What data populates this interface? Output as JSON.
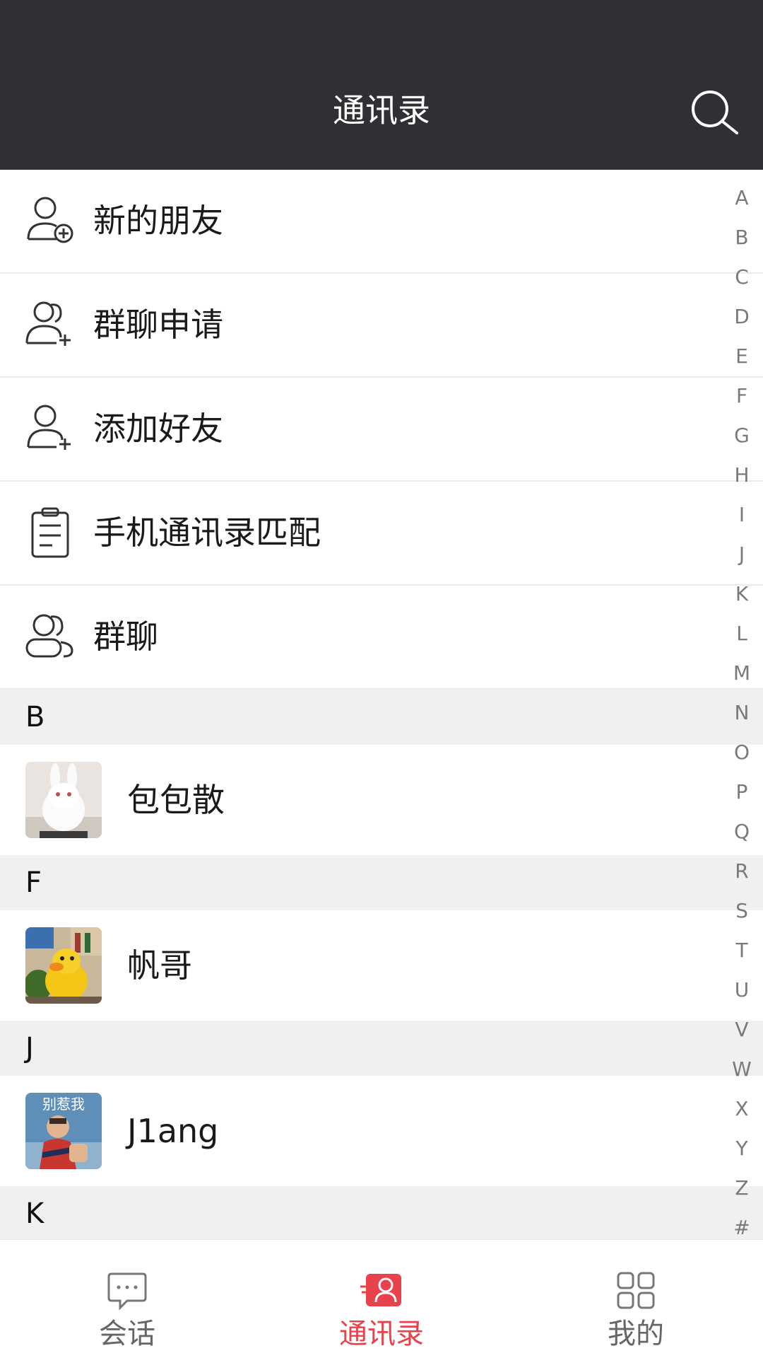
{
  "header": {
    "title": "通讯录",
    "search_icon": "search-icon"
  },
  "functions": [
    {
      "label": "新的朋友",
      "icon": "add-contact-icon"
    },
    {
      "label": "群聊申请",
      "icon": "group-add-icon"
    },
    {
      "label": "添加好友",
      "icon": "add-friend-icon"
    },
    {
      "label": "手机通讯录匹配",
      "icon": "clipboard-icon"
    },
    {
      "label": "群聊",
      "icon": "group-icon"
    }
  ],
  "sections": [
    {
      "letter": "B",
      "contacts": [
        {
          "name": "包包散",
          "avatar": "white-rabbit-avatar"
        }
      ]
    },
    {
      "letter": "F",
      "contacts": [
        {
          "name": "帆哥",
          "avatar": "yellow-duck-avatar"
        }
      ]
    },
    {
      "letter": "J",
      "contacts": [
        {
          "name": "J1ang",
          "avatar": "child-photo-avatar",
          "avatar_caption": "别惹我"
        }
      ]
    },
    {
      "letter": "K",
      "contacts": []
    }
  ],
  "index_letters": [
    "A",
    "B",
    "C",
    "D",
    "E",
    "F",
    "G",
    "H",
    "I",
    "J",
    "K",
    "L",
    "M",
    "N",
    "O",
    "P",
    "Q",
    "R",
    "S",
    "T",
    "U",
    "V",
    "W",
    "X",
    "Y",
    "Z",
    "#"
  ],
  "tabbar": {
    "items": [
      {
        "label": "会话",
        "icon": "chat-bubble-icon",
        "active": false
      },
      {
        "label": "通讯录",
        "icon": "contacts-card-icon",
        "active": true
      },
      {
        "label": "我的",
        "icon": "grid-icon",
        "active": false
      }
    ],
    "active_color": "#e8424d",
    "inactive_color": "#666666"
  },
  "colors": {
    "header_bg": "#2f3033",
    "section_bg": "#f0f0f0"
  }
}
